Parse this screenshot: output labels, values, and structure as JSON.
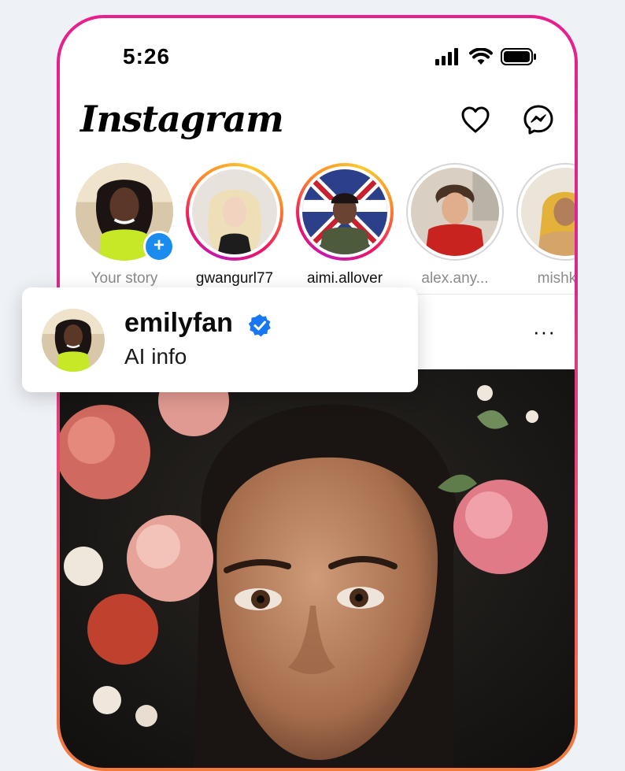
{
  "status_bar": {
    "time": "5:26"
  },
  "header": {
    "logo": "Instagram",
    "icons": [
      "heart-icon",
      "messenger-icon"
    ]
  },
  "stories": [
    {
      "username": "Your story",
      "ring": "none",
      "add_badge": "+"
    },
    {
      "username": "gwangurl77",
      "ring": "active"
    },
    {
      "username": "aimi.allover",
      "ring": "active"
    },
    {
      "username": "alex.any...",
      "ring": "seen"
    },
    {
      "username": "mishka_",
      "ring": "seen"
    }
  ],
  "post": {
    "more": "···"
  },
  "popup": {
    "name": "emilyfan",
    "subtitle": "AI info",
    "verified": true
  },
  "colors": {
    "accent": "#1a8cf0",
    "verified": "#1877f2",
    "frame_top": "#e91e8c",
    "frame_bottom": "#f47b3a"
  }
}
